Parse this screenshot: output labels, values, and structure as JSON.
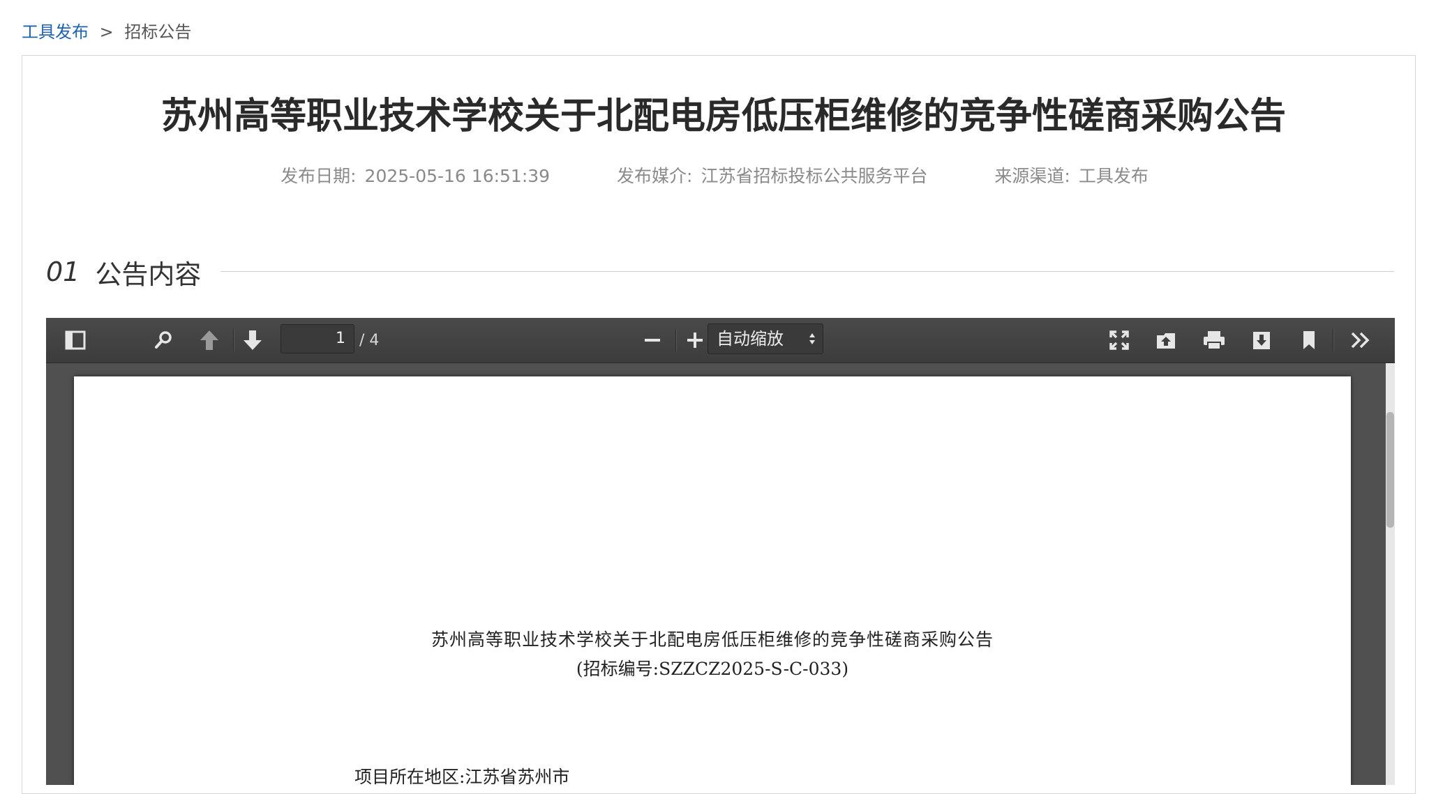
{
  "breadcrumb": {
    "link": "工具发布",
    "separator": ">",
    "current": "招标公告"
  },
  "announcement": {
    "title": "苏州高等职业技术学校关于北配电房低压柜维修的竞争性磋商采购公告",
    "meta": {
      "date_label": "发布日期:",
      "date_value": "2025-05-16 16:51:39",
      "media_label": "发布媒介:",
      "media_value": "江苏省招标投标公共服务平台",
      "source_label": "来源渠道:",
      "source_value": "工具发布"
    }
  },
  "section": {
    "number": "01",
    "title": "公告内容"
  },
  "pdf_viewer": {
    "page_number": "1",
    "page_count": "/ 4",
    "zoom_option": "自动缩放",
    "icons": [
      "sidebar-toggle-icon",
      "search-icon",
      "previous-page-icon",
      "next-page-icon",
      "zoom-out-icon",
      "zoom-in-icon",
      "fullscreen-icon",
      "open-file-icon",
      "print-icon",
      "download-icon",
      "bookmark-icon",
      "tools-icon"
    ],
    "page_content": {
      "title": "苏州高等职业技术学校关于北配电房低压柜维修的竞争性磋商采购公告",
      "bid_code": "(招标编号:SZZCZ2025-S-C-033)",
      "location_line": "项目所在地区:江苏省苏州市"
    }
  },
  "colors": {
    "link": "#1e62b0",
    "toolbar": "#3c3c3c",
    "viewer_bg": "#505050"
  }
}
